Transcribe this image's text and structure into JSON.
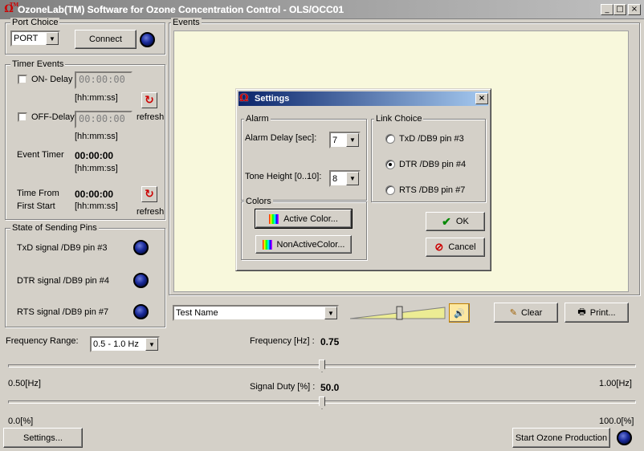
{
  "window": {
    "title": "OzoneLab(TM) Software for Ozone Concentration Control - OLS/OCC01",
    "minimize": "_",
    "maximize": "□",
    "close": "×"
  },
  "port_choice": {
    "label": "Port Choice",
    "select_value": "PORT",
    "connect_label": "Connect"
  },
  "timer_events": {
    "label": "Timer Events",
    "on_delay_label": "ON- Delay",
    "on_delay_value": "00:00:00",
    "on_delay_format": "[hh:mm:ss]",
    "off_delay_label": "OFF-Delay",
    "off_delay_value": "00:00:00",
    "off_delay_format": "[hh:mm:ss]",
    "refresh_label": "refresh",
    "event_timer_label": "Event Timer",
    "event_timer_value": "00:00:00",
    "event_timer_format": "[hh:mm:ss]",
    "time_from_label1": "Time From",
    "time_from_label2": "First Start",
    "time_from_value": "00:00:00",
    "time_from_format": "[hh:mm:ss]",
    "refresh2_label": "refresh"
  },
  "sending_pins": {
    "label": "State of Sending Pins",
    "txd": "TxD signal  /DB9 pin #3",
    "dtr": "DTR signal /DB9 pin #4",
    "rts": "RTS signal /DB9 pin #7"
  },
  "events": {
    "label": "Events",
    "test_name": "Test Name",
    "clear_label": "Clear",
    "print_label": "Print..."
  },
  "frequency": {
    "range_label": "Frequency Range:",
    "range_value": "0.5 - 1.0 Hz",
    "freq_label": "Frequency [Hz] :",
    "freq_value": "0.75",
    "min_label": "0.50[Hz]",
    "max_label": "1.00[Hz]",
    "duty_label": "Signal Duty [%] :",
    "duty_value": "50.0",
    "duty_min": "0.0[%]",
    "duty_max": "100.0[%]"
  },
  "bottom": {
    "settings_label": "Settings...",
    "start_label": "Start Ozone Production"
  },
  "settings_dialog": {
    "title": "Settings",
    "alarm_label": "Alarm",
    "alarm_delay_label": "Alarm Delay [sec]:",
    "alarm_delay_value": "7",
    "tone_height_label": "Tone Height [0..10]:",
    "tone_height_value": "8",
    "colors_label": "Colors",
    "active_color_label": "Active Color...",
    "nonactive_color_label": "NonActiveColor...",
    "link_choice_label": "Link Choice",
    "link_txd": "TxD  /DB9 pin #3",
    "link_dtr": "DTR /DB9 pin #4",
    "link_rts": "RTS /DB9 pin #7",
    "link_selected": "DTR",
    "ok_label": "OK",
    "cancel_label": "Cancel"
  },
  "colors": {
    "events_bg": "#f8f8dc",
    "title_gradient_start": "#0a246a",
    "led_blue": "#1a2a9a"
  }
}
